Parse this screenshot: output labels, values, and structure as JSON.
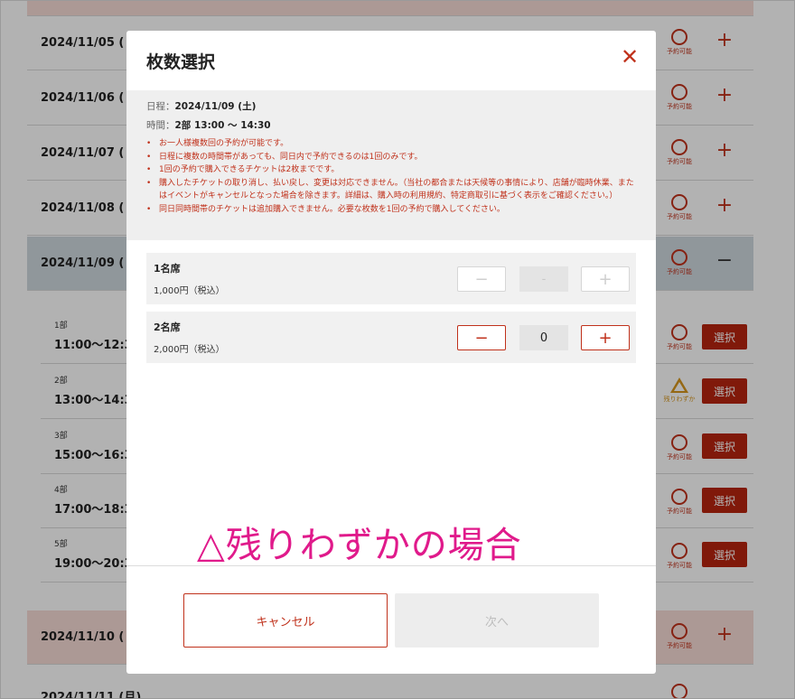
{
  "background": {
    "dates": [
      {
        "label": "2024/11/05 (",
        "status": "予約可能",
        "state": "plus"
      },
      {
        "label": "2024/11/06 (",
        "status": "予約可能",
        "state": "plus"
      },
      {
        "label": "2024/11/07 (",
        "status": "予約可能",
        "state": "plus"
      },
      {
        "label": "2024/11/08 (",
        "status": "予約可能",
        "state": "plus"
      },
      {
        "label": "2024/11/09 (",
        "status": "予約可能",
        "state": "minus"
      }
    ],
    "slots": [
      {
        "part": "1部",
        "time": "11:00〜12:3",
        "status": "予約可能",
        "button": "選択"
      },
      {
        "part": "2部",
        "time": "13:00〜14:3",
        "status": "残りわずか",
        "button": "選択"
      },
      {
        "part": "3部",
        "time": "15:00〜16:3",
        "status": "予約可能",
        "button": "選択"
      },
      {
        "part": "4部",
        "time": "17:00〜18:3",
        "status": "予約可能",
        "button": "選択"
      },
      {
        "part": "5部",
        "time": "19:00〜20:3",
        "status": "予約可能",
        "button": "選択"
      }
    ],
    "after_dates": [
      {
        "label": "2024/11/10 (",
        "status": "予約可能"
      },
      {
        "label": "2024/11/11 (月)",
        "status": ""
      }
    ]
  },
  "modal": {
    "title": "枚数選択",
    "schedule_label": "日程：",
    "schedule_value": "2024/11/09 (土)",
    "time_label": "時間：",
    "time_value": "2部 13:00 〜 14:30",
    "notes": [
      "お一人様複数回の予約が可能です。",
      "日程に複数の時間帯があっても、同日内で予約できるのは1回のみです。",
      "1回の予約で購入できるチケットは2枚までです。",
      "購入したチケットの取り消し、払い戻し、変更は対応できません。（当社の都合または天候等の事情により、店舗が臨時休業、またはイベントがキャンセルとなった場合を除きます。詳細は、購入時の利用規約、特定商取引に基づく表示をご確認ください。）",
      "同日同時間帯のチケットは追加購入できません。必要な枚数を1回の予約で購入してください。"
    ],
    "seats": [
      {
        "name": "1名席",
        "price": "1,000円（税込）",
        "qty": "-",
        "disabled": true
      },
      {
        "name": "2名席",
        "price": "2,000円（税込）",
        "qty": "0",
        "disabled": false
      }
    ],
    "annotation": "△残りわずかの場合",
    "cancel_label": "キャンセル",
    "next_label": "次へ"
  },
  "colors": {
    "accent": "#c0311b",
    "warning": "#d6961d",
    "annotation": "#e01a8b"
  }
}
